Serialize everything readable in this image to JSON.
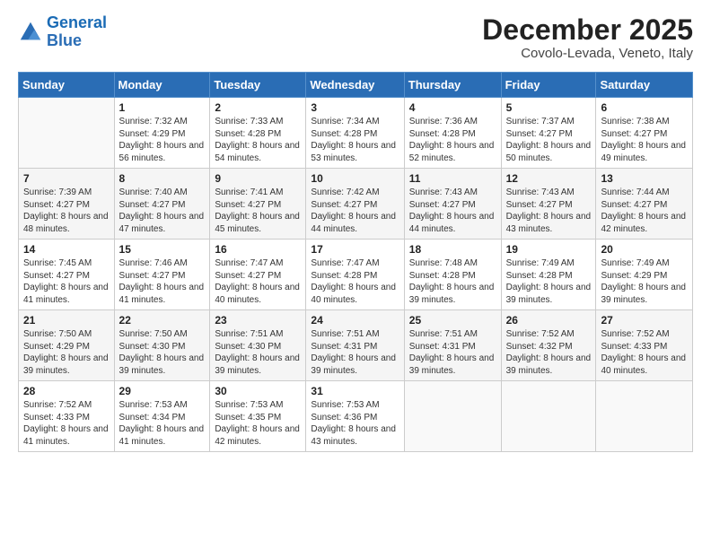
{
  "header": {
    "logo_line1": "General",
    "logo_line2": "Blue",
    "month": "December 2025",
    "location": "Covolo-Levada, Veneto, Italy"
  },
  "weekdays": [
    "Sunday",
    "Monday",
    "Tuesday",
    "Wednesday",
    "Thursday",
    "Friday",
    "Saturday"
  ],
  "weeks": [
    [
      {
        "day": "",
        "sunrise": "",
        "sunset": "",
        "daylight": ""
      },
      {
        "day": "1",
        "sunrise": "Sunrise: 7:32 AM",
        "sunset": "Sunset: 4:29 PM",
        "daylight": "Daylight: 8 hours and 56 minutes."
      },
      {
        "day": "2",
        "sunrise": "Sunrise: 7:33 AM",
        "sunset": "Sunset: 4:28 PM",
        "daylight": "Daylight: 8 hours and 54 minutes."
      },
      {
        "day": "3",
        "sunrise": "Sunrise: 7:34 AM",
        "sunset": "Sunset: 4:28 PM",
        "daylight": "Daylight: 8 hours and 53 minutes."
      },
      {
        "day": "4",
        "sunrise": "Sunrise: 7:36 AM",
        "sunset": "Sunset: 4:28 PM",
        "daylight": "Daylight: 8 hours and 52 minutes."
      },
      {
        "day": "5",
        "sunrise": "Sunrise: 7:37 AM",
        "sunset": "Sunset: 4:27 PM",
        "daylight": "Daylight: 8 hours and 50 minutes."
      },
      {
        "day": "6",
        "sunrise": "Sunrise: 7:38 AM",
        "sunset": "Sunset: 4:27 PM",
        "daylight": "Daylight: 8 hours and 49 minutes."
      }
    ],
    [
      {
        "day": "7",
        "sunrise": "Sunrise: 7:39 AM",
        "sunset": "Sunset: 4:27 PM",
        "daylight": "Daylight: 8 hours and 48 minutes."
      },
      {
        "day": "8",
        "sunrise": "Sunrise: 7:40 AM",
        "sunset": "Sunset: 4:27 PM",
        "daylight": "Daylight: 8 hours and 47 minutes."
      },
      {
        "day": "9",
        "sunrise": "Sunrise: 7:41 AM",
        "sunset": "Sunset: 4:27 PM",
        "daylight": "Daylight: 8 hours and 45 minutes."
      },
      {
        "day": "10",
        "sunrise": "Sunrise: 7:42 AM",
        "sunset": "Sunset: 4:27 PM",
        "daylight": "Daylight: 8 hours and 44 minutes."
      },
      {
        "day": "11",
        "sunrise": "Sunrise: 7:43 AM",
        "sunset": "Sunset: 4:27 PM",
        "daylight": "Daylight: 8 hours and 44 minutes."
      },
      {
        "day": "12",
        "sunrise": "Sunrise: 7:43 AM",
        "sunset": "Sunset: 4:27 PM",
        "daylight": "Daylight: 8 hours and 43 minutes."
      },
      {
        "day": "13",
        "sunrise": "Sunrise: 7:44 AM",
        "sunset": "Sunset: 4:27 PM",
        "daylight": "Daylight: 8 hours and 42 minutes."
      }
    ],
    [
      {
        "day": "14",
        "sunrise": "Sunrise: 7:45 AM",
        "sunset": "Sunset: 4:27 PM",
        "daylight": "Daylight: 8 hours and 41 minutes."
      },
      {
        "day": "15",
        "sunrise": "Sunrise: 7:46 AM",
        "sunset": "Sunset: 4:27 PM",
        "daylight": "Daylight: 8 hours and 41 minutes."
      },
      {
        "day": "16",
        "sunrise": "Sunrise: 7:47 AM",
        "sunset": "Sunset: 4:27 PM",
        "daylight": "Daylight: 8 hours and 40 minutes."
      },
      {
        "day": "17",
        "sunrise": "Sunrise: 7:47 AM",
        "sunset": "Sunset: 4:28 PM",
        "daylight": "Daylight: 8 hours and 40 minutes."
      },
      {
        "day": "18",
        "sunrise": "Sunrise: 7:48 AM",
        "sunset": "Sunset: 4:28 PM",
        "daylight": "Daylight: 8 hours and 39 minutes."
      },
      {
        "day": "19",
        "sunrise": "Sunrise: 7:49 AM",
        "sunset": "Sunset: 4:28 PM",
        "daylight": "Daylight: 8 hours and 39 minutes."
      },
      {
        "day": "20",
        "sunrise": "Sunrise: 7:49 AM",
        "sunset": "Sunset: 4:29 PM",
        "daylight": "Daylight: 8 hours and 39 minutes."
      }
    ],
    [
      {
        "day": "21",
        "sunrise": "Sunrise: 7:50 AM",
        "sunset": "Sunset: 4:29 PM",
        "daylight": "Daylight: 8 hours and 39 minutes."
      },
      {
        "day": "22",
        "sunrise": "Sunrise: 7:50 AM",
        "sunset": "Sunset: 4:30 PM",
        "daylight": "Daylight: 8 hours and 39 minutes."
      },
      {
        "day": "23",
        "sunrise": "Sunrise: 7:51 AM",
        "sunset": "Sunset: 4:30 PM",
        "daylight": "Daylight: 8 hours and 39 minutes."
      },
      {
        "day": "24",
        "sunrise": "Sunrise: 7:51 AM",
        "sunset": "Sunset: 4:31 PM",
        "daylight": "Daylight: 8 hours and 39 minutes."
      },
      {
        "day": "25",
        "sunrise": "Sunrise: 7:51 AM",
        "sunset": "Sunset: 4:31 PM",
        "daylight": "Daylight: 8 hours and 39 minutes."
      },
      {
        "day": "26",
        "sunrise": "Sunrise: 7:52 AM",
        "sunset": "Sunset: 4:32 PM",
        "daylight": "Daylight: 8 hours and 39 minutes."
      },
      {
        "day": "27",
        "sunrise": "Sunrise: 7:52 AM",
        "sunset": "Sunset: 4:33 PM",
        "daylight": "Daylight: 8 hours and 40 minutes."
      }
    ],
    [
      {
        "day": "28",
        "sunrise": "Sunrise: 7:52 AM",
        "sunset": "Sunset: 4:33 PM",
        "daylight": "Daylight: 8 hours and 41 minutes."
      },
      {
        "day": "29",
        "sunrise": "Sunrise: 7:53 AM",
        "sunset": "Sunset: 4:34 PM",
        "daylight": "Daylight: 8 hours and 41 minutes."
      },
      {
        "day": "30",
        "sunrise": "Sunrise: 7:53 AM",
        "sunset": "Sunset: 4:35 PM",
        "daylight": "Daylight: 8 hours and 42 minutes."
      },
      {
        "day": "31",
        "sunrise": "Sunrise: 7:53 AM",
        "sunset": "Sunset: 4:36 PM",
        "daylight": "Daylight: 8 hours and 43 minutes."
      },
      {
        "day": "",
        "sunrise": "",
        "sunset": "",
        "daylight": ""
      },
      {
        "day": "",
        "sunrise": "",
        "sunset": "",
        "daylight": ""
      },
      {
        "day": "",
        "sunrise": "",
        "sunset": "",
        "daylight": ""
      }
    ]
  ]
}
